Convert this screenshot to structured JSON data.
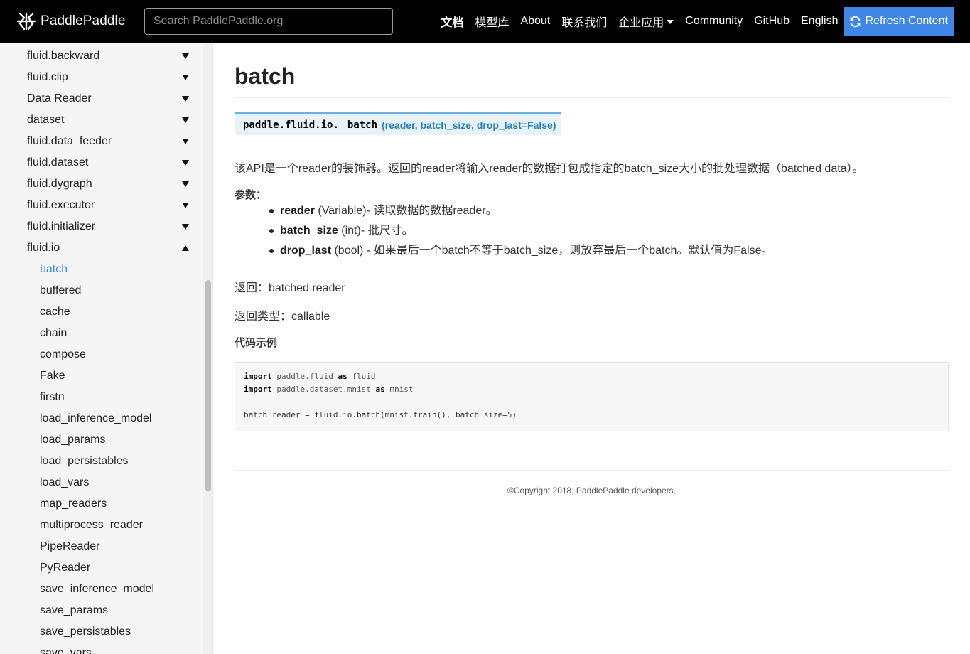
{
  "header": {
    "brand": "PaddlePaddle",
    "search_placeholder": "Search PaddlePaddle.org",
    "nav": [
      {
        "label": "文档"
      },
      {
        "label": "模型库"
      },
      {
        "label": "About"
      },
      {
        "label": "联系我们"
      },
      {
        "label": "企业应用"
      },
      {
        "label": "Community"
      },
      {
        "label": "GitHub"
      },
      {
        "label": "English"
      }
    ],
    "refresh_label": "Refresh Content"
  },
  "sidebar": {
    "items": [
      {
        "label": "fluid.backward"
      },
      {
        "label": "fluid.clip"
      },
      {
        "label": "Data Reader"
      },
      {
        "label": "dataset"
      },
      {
        "label": "fluid.data_feeder"
      },
      {
        "label": "fluid.dataset"
      },
      {
        "label": "fluid.dygraph"
      },
      {
        "label": "fluid.executor"
      },
      {
        "label": "fluid.initializer"
      },
      {
        "label": "fluid.io"
      }
    ],
    "sub_items": [
      {
        "label": "batch"
      },
      {
        "label": "buffered"
      },
      {
        "label": "cache"
      },
      {
        "label": "chain"
      },
      {
        "label": "compose"
      },
      {
        "label": "Fake"
      },
      {
        "label": "firstn"
      },
      {
        "label": "load_inference_model"
      },
      {
        "label": "load_params"
      },
      {
        "label": "load_persistables"
      },
      {
        "label": "load_vars"
      },
      {
        "label": "map_readers"
      },
      {
        "label": "multiprocess_reader"
      },
      {
        "label": "PipeReader"
      },
      {
        "label": "PyReader"
      },
      {
        "label": "save_inference_model"
      },
      {
        "label": "save_params"
      },
      {
        "label": "save_persistables"
      },
      {
        "label": "save_vars"
      }
    ]
  },
  "content": {
    "title": "batch",
    "signature": {
      "module": "paddle.fluid.io.",
      "name": "batch",
      "args": "(reader, batch_size, drop_last=False)"
    },
    "description": "该API是一个reader的装饰器。返回的reader将输入reader的数据打包成指定的batch_size大小的批处理数据（batched data）。",
    "params_title": "参数：",
    "params": [
      {
        "name": "reader",
        "desc": " (Variable)- 读取数据的数据reader。"
      },
      {
        "name": "batch_size",
        "desc": " (int)- 批尺寸。"
      },
      {
        "name": "drop_last",
        "desc": " (bool) - 如果最后一个batch不等于batch_size，则放弃最后一个batch。默认值为False。"
      }
    ],
    "returns": "返回：batched reader",
    "return_type": "返回类型：callable",
    "example_title": "代码示例",
    "code": {
      "line1": {
        "kw1": "import",
        "mod": " paddle.fluid ",
        "kw2": "as",
        "alias": " fluid"
      },
      "line2": {
        "kw1": "import",
        "mod": " paddle.dataset.mnist ",
        "kw2": "as",
        "alias": " mnist"
      },
      "line3": {
        "pre": "batch_reader = fluid.io.batch(mnist.train(), batch_size=",
        "num": "5",
        "post": ")"
      }
    },
    "footer": "©Copyright 2018, PaddlePaddle developers."
  }
}
